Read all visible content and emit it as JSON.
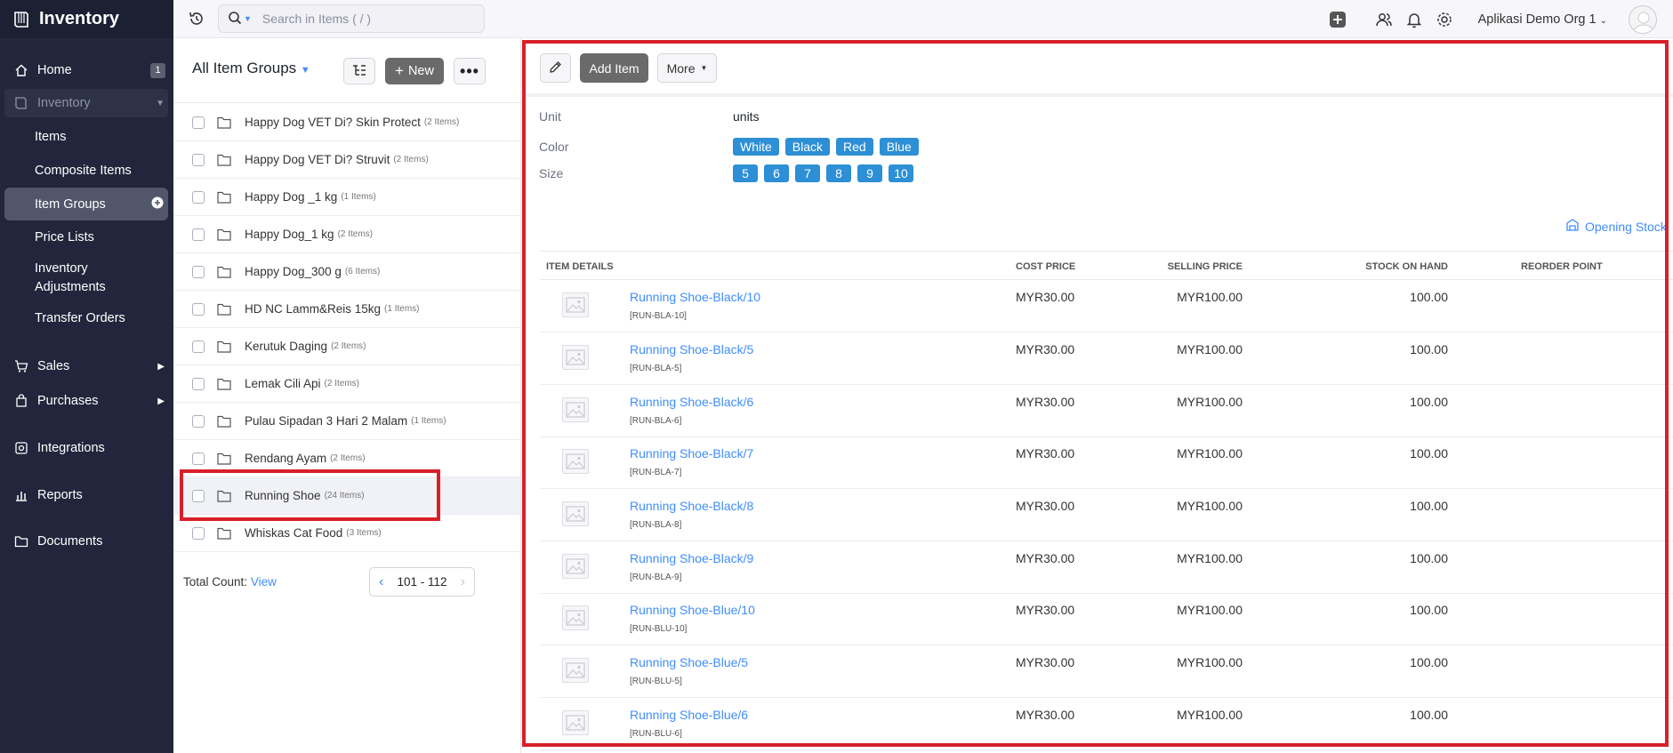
{
  "app": {
    "title": "Inventory"
  },
  "sidebar": {
    "home": {
      "label": "Home",
      "badge": "1"
    },
    "inventory": {
      "label": "Inventory"
    },
    "sub_items": [
      "Items",
      "Composite Items",
      "Item Groups",
      "Price Lists",
      "Inventory Adjustments",
      "Transfer Orders"
    ],
    "sales": "Sales",
    "purchases": "Purchases",
    "integrations": "Integrations",
    "reports": "Reports",
    "documents": "Documents"
  },
  "topbar": {
    "search_placeholder": "Search in Items ( / )",
    "org_name": "Aplikasi Demo Org 1"
  },
  "list": {
    "title": "All Item Groups",
    "new_label": "New",
    "rows": [
      {
        "name": "Happy Dog VET Di? Skin Protect",
        "count": "(2 Items)"
      },
      {
        "name": "Happy Dog VET Di? Struvit",
        "count": "(2 Items)"
      },
      {
        "name": "Happy Dog _1 kg",
        "count": "(1 Items)"
      },
      {
        "name": "Happy Dog_1 kg",
        "count": "(2 Items)"
      },
      {
        "name": "Happy Dog_300 g",
        "count": "(6 Items)"
      },
      {
        "name": "HD NC Lamm&Reis 15kg",
        "count": "(1 Items)"
      },
      {
        "name": "Kerutuk Daging",
        "count": "(2 Items)"
      },
      {
        "name": "Lemak Cili Api",
        "count": "(2 Items)"
      },
      {
        "name": "Pulau Sipadan 3 Hari 2 Malam",
        "count": "(1 Items)"
      },
      {
        "name": "Rendang Ayam",
        "count": "(2 Items)"
      },
      {
        "name": "Running Shoe",
        "count": "(24 Items)"
      },
      {
        "name": "Whiskas Cat Food",
        "count": "(3 Items)"
      }
    ],
    "total_label": "Total Count:",
    "total_link": "View",
    "pager_range": "101 - 112"
  },
  "detail": {
    "add_item_label": "Add Item",
    "more_label": "More",
    "unit_label": "Unit",
    "unit_value": "units",
    "color_label": "Color",
    "colors": [
      "White",
      "Black",
      "Red",
      "Blue"
    ],
    "size_label": "Size",
    "sizes": [
      "5",
      "6",
      "7",
      "8",
      "9",
      "10"
    ],
    "opening_stock": "Opening Stock",
    "columns": [
      "ITEM DETAILS",
      "COST PRICE",
      "SELLING PRICE",
      "STOCK ON HAND",
      "REORDER POINT"
    ],
    "items": [
      {
        "name": "Running Shoe-Black/10",
        "sku": "[RUN-BLA-10]",
        "cost": "MYR30.00",
        "sell": "MYR100.00",
        "stock": "100.00"
      },
      {
        "name": "Running Shoe-Black/5",
        "sku": "[RUN-BLA-5]",
        "cost": "MYR30.00",
        "sell": "MYR100.00",
        "stock": "100.00"
      },
      {
        "name": "Running Shoe-Black/6",
        "sku": "[RUN-BLA-6]",
        "cost": "MYR30.00",
        "sell": "MYR100.00",
        "stock": "100.00"
      },
      {
        "name": "Running Shoe-Black/7",
        "sku": "[RUN-BLA-7]",
        "cost": "MYR30.00",
        "sell": "MYR100.00",
        "stock": "100.00"
      },
      {
        "name": "Running Shoe-Black/8",
        "sku": "[RUN-BLA-8]",
        "cost": "MYR30.00",
        "sell": "MYR100.00",
        "stock": "100.00"
      },
      {
        "name": "Running Shoe-Black/9",
        "sku": "[RUN-BLA-9]",
        "cost": "MYR30.00",
        "sell": "MYR100.00",
        "stock": "100.00"
      },
      {
        "name": "Running Shoe-Blue/10",
        "sku": "[RUN-BLU-10]",
        "cost": "MYR30.00",
        "sell": "MYR100.00",
        "stock": "100.00"
      },
      {
        "name": "Running Shoe-Blue/5",
        "sku": "[RUN-BLU-5]",
        "cost": "MYR30.00",
        "sell": "MYR100.00",
        "stock": "100.00"
      },
      {
        "name": "Running Shoe-Blue/6",
        "sku": "[RUN-BLU-6]",
        "cost": "MYR30.00",
        "sell": "MYR100.00",
        "stock": "100.00"
      }
    ]
  },
  "colors": {
    "sidebar_bg": "#21263c",
    "accent_link": "#408dfb",
    "chip": "#2d8fd5",
    "highlight": "#d8202a"
  }
}
